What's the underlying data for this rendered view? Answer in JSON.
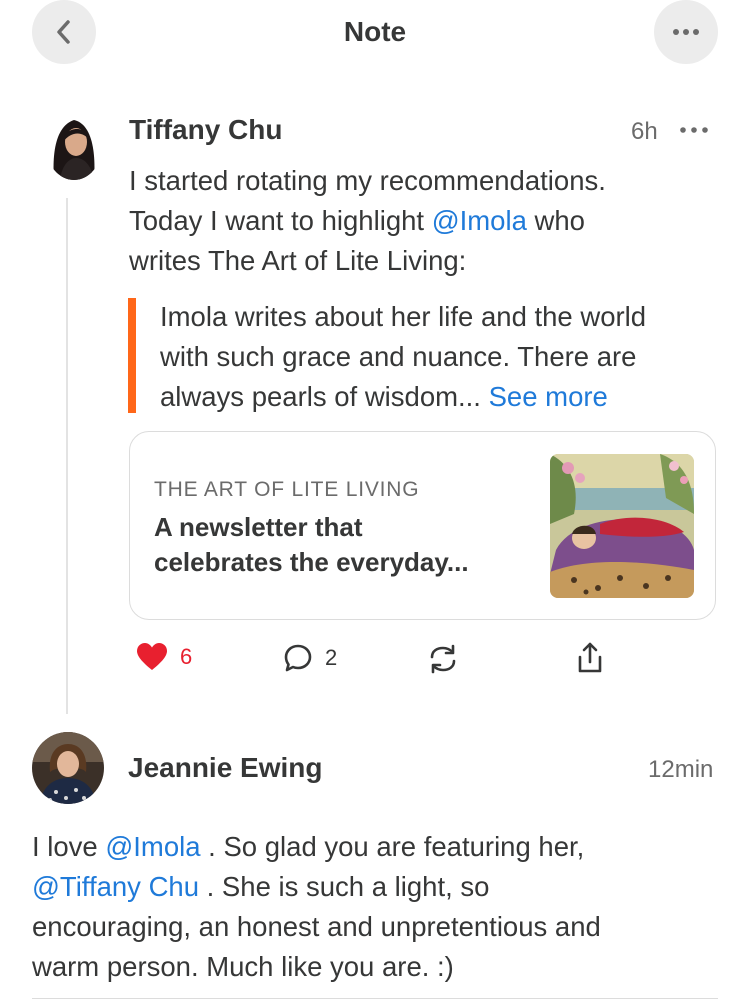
{
  "header": {
    "title": "Note"
  },
  "post": {
    "author": "Tiffany Chu",
    "time": "6h",
    "text_line1": "I started rotating my recommendations.",
    "text_line2_before": "Today I want to highlight ",
    "mention": "@Imola",
    "text_line2_after": " who",
    "text_line3": "writes The Art of Lite Living:",
    "quote_line1": "Imola writes about her life and the world",
    "quote_line2": "with such grace and nuance. There are",
    "quote_line3": "always pearls of wisdom... ",
    "see_more": "See more",
    "card": {
      "publication": "THE ART OF LITE LIVING",
      "description_line1": "A newsletter that",
      "description_line2": "celebrates the everyday..."
    },
    "likes": "6",
    "comments": "2"
  },
  "reply": {
    "author": "Jeannie Ewing",
    "time": "12min",
    "line1_before": "I love ",
    "mention1": "@Imola",
    "line1_after": " . So glad you are featuring her,",
    "mention2": "@Tiffany Chu",
    "line2_after": " . She is such a light, so",
    "line3": "encouraging, an honest and unpretentious and",
    "line4": "warm person. Much like you are. :)"
  },
  "colors": {
    "accent": "#ff6719",
    "link": "#1f7ad9",
    "like": "#e8202f",
    "text": "#363737",
    "muted": "#6b6b6b"
  },
  "icons": [
    "back-chevron-icon",
    "ellipsis-icon",
    "heart-icon",
    "comment-icon",
    "restack-icon",
    "share-icon"
  ]
}
